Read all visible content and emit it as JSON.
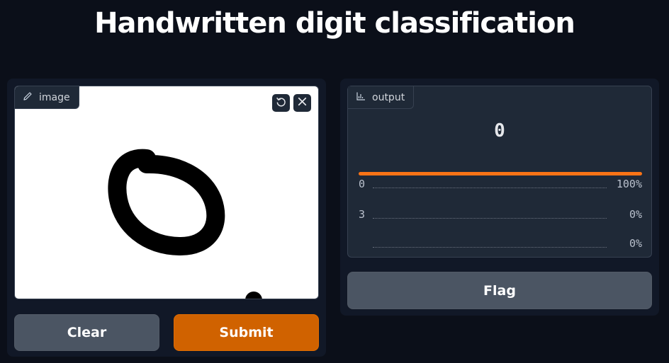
{
  "page": {
    "title": "Handwritten digit classification"
  },
  "input": {
    "label": "image",
    "icons": {
      "tag": "pencil-icon",
      "undo": "undo-icon",
      "close": "close-icon"
    }
  },
  "buttons": {
    "clear": "Clear",
    "submit": "Submit",
    "flag": "Flag"
  },
  "output": {
    "label": "output",
    "tag_icon": "bar-chart-icon",
    "prediction": "0",
    "confidences": [
      {
        "label": "0",
        "value": "100%",
        "fraction": 1.0
      },
      {
        "label": "3",
        "value": "0%",
        "fraction": 0.0
      },
      {
        "label": "",
        "value": "0%",
        "fraction": 0.0
      }
    ]
  },
  "colors": {
    "background": "#0b0f19",
    "panel": "#111827",
    "accent": "#d06200",
    "confidence_bar": "#f97316"
  }
}
